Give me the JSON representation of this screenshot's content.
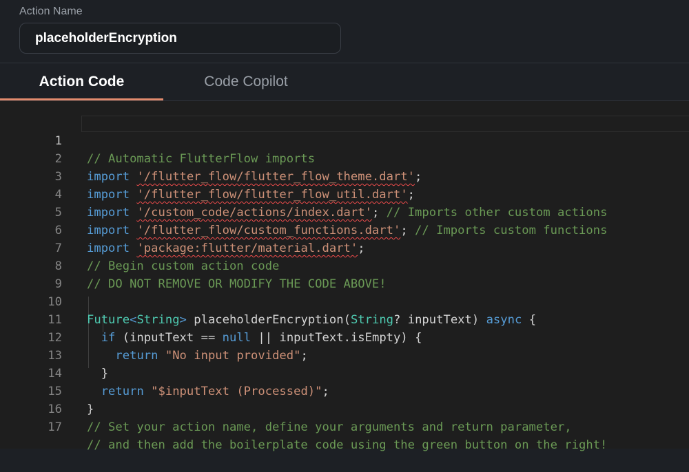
{
  "action_name": {
    "label": "Action Name",
    "value": "placeholderEncryption"
  },
  "tabs": [
    {
      "label": "Action Code",
      "active": true
    },
    {
      "label": "Code Copilot",
      "active": false
    }
  ],
  "editor": {
    "line_numbers": [
      "1",
      "2",
      "3",
      "4",
      "5",
      "6",
      "7",
      "8",
      "9",
      "10",
      "11",
      "12",
      "13",
      "14",
      "15",
      "16",
      "17"
    ],
    "active_line": "1",
    "lines": {
      "l1": {
        "comment": "// Automatic FlutterFlow imports"
      },
      "l2": {
        "kw": "import",
        "str": "'/flutter_flow/flutter_flow_theme.dart'",
        "end": ";"
      },
      "l3": {
        "kw": "import",
        "str": "'/flutter_flow/flutter_flow_util.dart'",
        "end": ";"
      },
      "l4": {
        "kw": "import",
        "str": "'/custom_code/actions/index.dart'",
        "end": ";",
        "comment": "// Imports other custom actions"
      },
      "l5": {
        "kw": "import",
        "str": "'/flutter_flow/custom_functions.dart'",
        "end": ";",
        "comment": "// Imports custom functions"
      },
      "l6": {
        "kw": "import",
        "str": "'package:flutter/material.dart'",
        "end": ";"
      },
      "l7": {
        "comment": "// Begin custom action code"
      },
      "l8": {
        "comment": "// DO NOT REMOVE OR MODIFY THE CODE ABOVE!"
      },
      "l10": {
        "type1": "Future",
        "lt": "<",
        "type2": "String",
        "gt": ">",
        "fn": "placeholderEncryption",
        "open": "(",
        "type3": "String",
        "param": "? inputText)",
        "kw": "async",
        "brace": "{"
      },
      "l11": {
        "kw": "if",
        "rest1": "(inputText ==",
        "null": "null",
        "rest2": "|| inputText.isEmpty) {"
      },
      "l12": {
        "kw": "return",
        "str": "\"No input provided\"",
        "end": ";"
      },
      "l13": {
        "text": "}"
      },
      "l14": {
        "kw": "return",
        "str": "\"$inputText (Processed)\"",
        "end": ";"
      },
      "l15": {
        "text": "}"
      },
      "l16": {
        "comment": "// Set your action name, define your arguments and return parameter,"
      },
      "l17": {
        "comment": "// and then add the boilerplate code using the green button on the right!"
      }
    }
  }
}
